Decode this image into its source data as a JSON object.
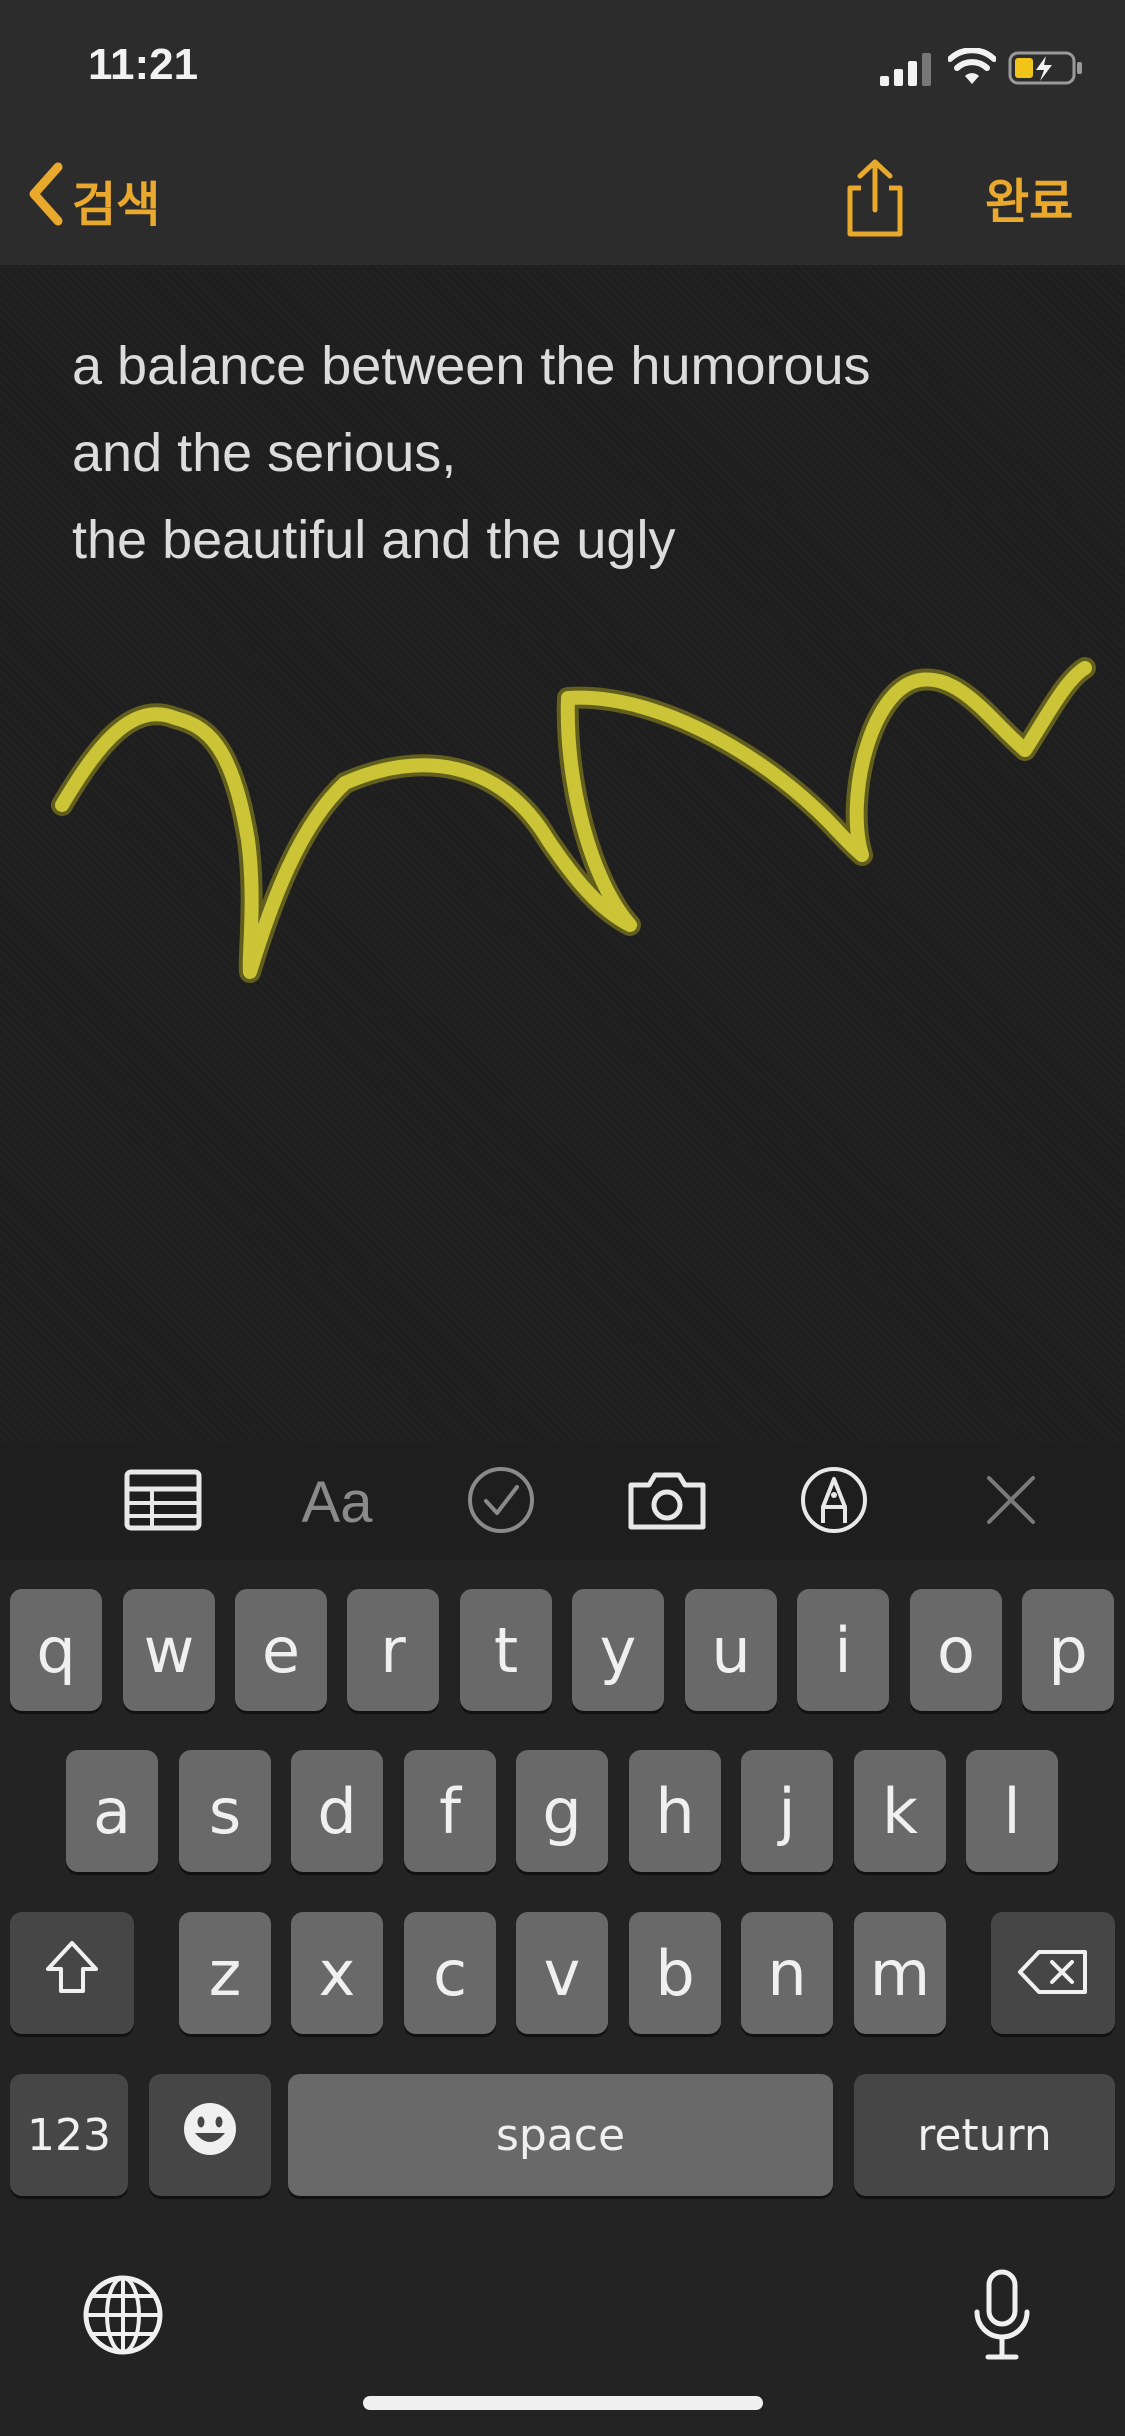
{
  "status_bar": {
    "time": "11:21"
  },
  "nav": {
    "back_label": "검색",
    "done_label": "완료"
  },
  "note": {
    "lines": [
      "a balance between the humorous",
      "and the serious,",
      "the beautiful and the ugly"
    ]
  },
  "toolbar": {
    "format_label": "Aa"
  },
  "keyboard": {
    "row1": [
      "q",
      "w",
      "e",
      "r",
      "t",
      "y",
      "u",
      "i",
      "o",
      "p"
    ],
    "row2": [
      "a",
      "s",
      "d",
      "f",
      "g",
      "h",
      "j",
      "k",
      "l"
    ],
    "row3": [
      "z",
      "x",
      "c",
      "v",
      "b",
      "n",
      "m"
    ],
    "numbers_label": "123",
    "space_label": "space",
    "return_label": "return"
  },
  "colors": {
    "accent": "#e8a92c",
    "highlighter": "#d8cf3a"
  }
}
